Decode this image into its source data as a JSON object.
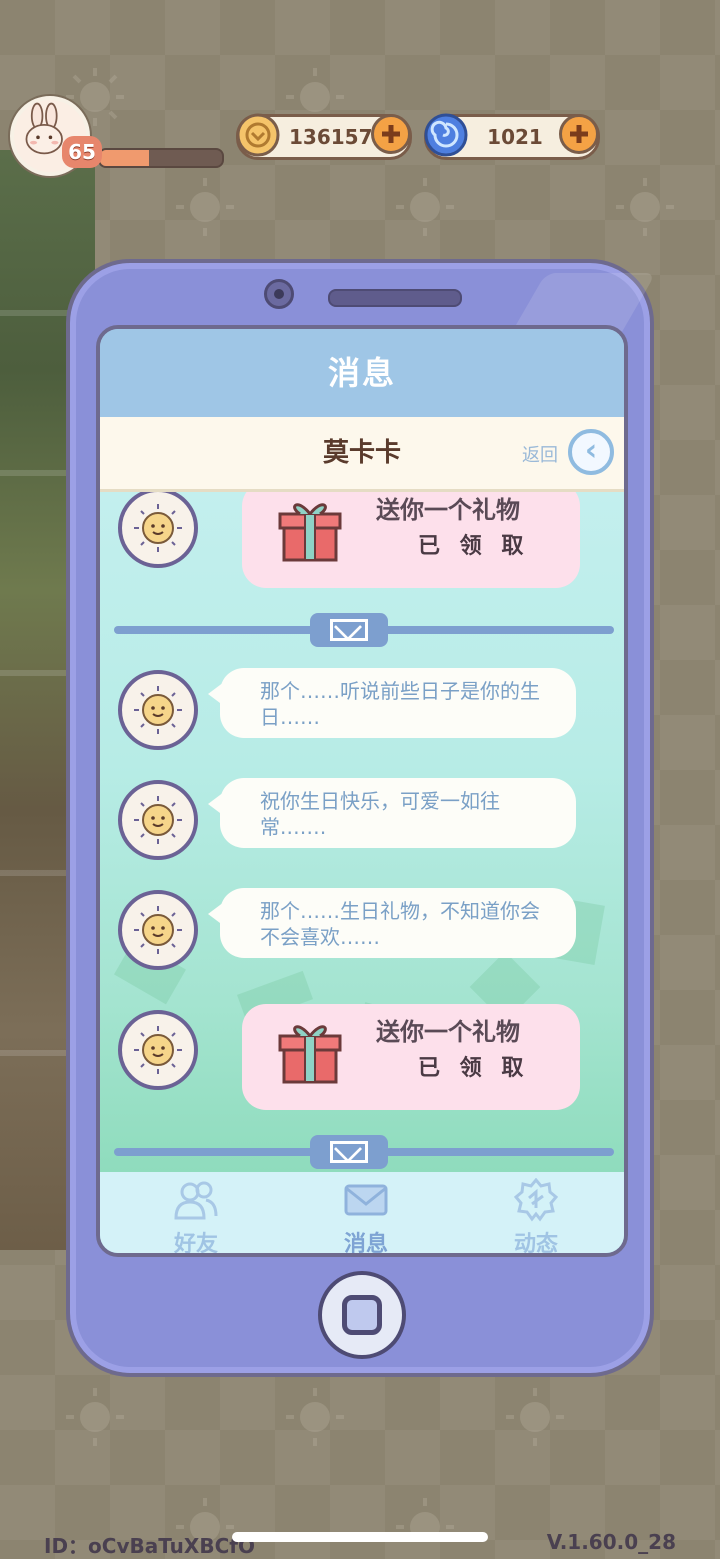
{
  "hud": {
    "level": "65",
    "xp_progress": 0.4,
    "coins": "136157",
    "gems": "1021"
  },
  "screen": {
    "title": "消息",
    "contact_name": "莫卡卡",
    "back_label": "返回"
  },
  "messages": {
    "gift_1": {
      "title": "送你一个礼物",
      "status": "已 领 取"
    },
    "text_1": "那个……听说前些日子是你的生日……",
    "text_2": "祝你生日快乐，可爱一如往常.……",
    "text_3": "那个……生日礼物，不知道你会不会喜欢……",
    "gift_2": {
      "title": "送你一个礼物",
      "status": "已 领 取"
    }
  },
  "tabs": [
    {
      "label": "好友",
      "icon": "friends-icon"
    },
    {
      "label": "消息",
      "icon": "mail-icon"
    },
    {
      "label": "动态",
      "icon": "feed-icon"
    }
  ],
  "footer": {
    "id": "ID：oCvBaTuXBCfO",
    "version": "V.1.60.0_28"
  },
  "colors": {
    "phone": "#8a90d8",
    "accent": "#7d9fcf",
    "gift_card": "#fde0eb"
  }
}
